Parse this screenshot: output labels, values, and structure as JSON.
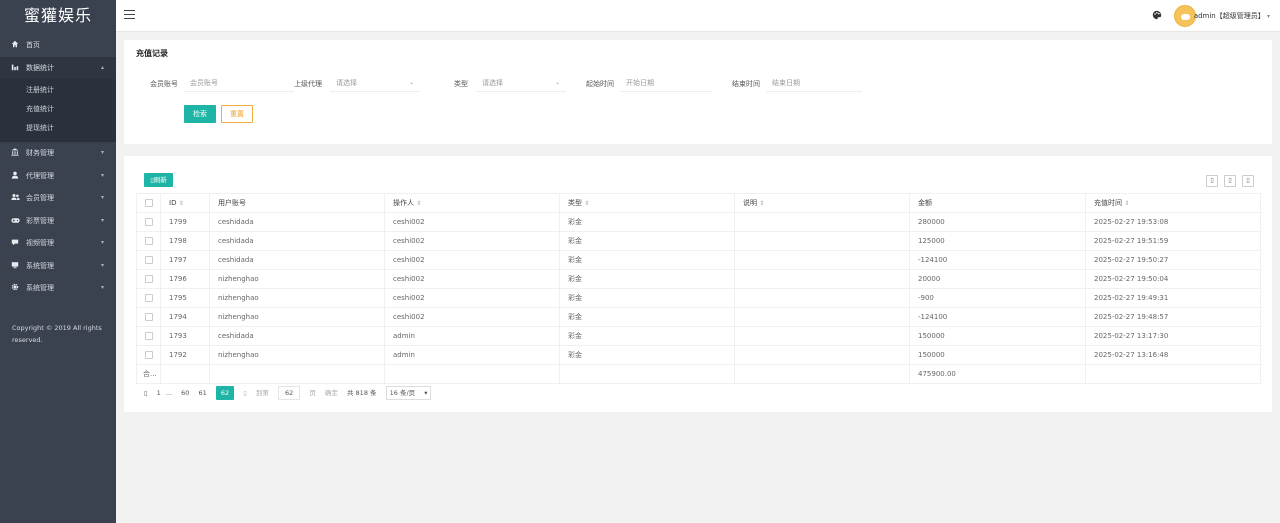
{
  "app": {
    "logo": "蜜獾娱乐"
  },
  "sidebar": {
    "home": {
      "label": "首页",
      "icon": "home-icon"
    },
    "stats": {
      "label": "数据统计",
      "icon": "chart-icon",
      "expanded": true,
      "children": [
        "注册统计",
        "充值统计",
        "提现统计"
      ]
    },
    "items": [
      {
        "label": "财务管理",
        "icon": "bank-icon"
      },
      {
        "label": "代理管理",
        "icon": "user-icon"
      },
      {
        "label": "会员管理",
        "icon": "users-icon"
      },
      {
        "label": "彩票管理",
        "icon": "gamepad-icon"
      },
      {
        "label": "视频管理",
        "icon": "video-icon"
      },
      {
        "label": "系统管理",
        "icon": "monitor-icon"
      },
      {
        "label": "系统管理",
        "icon": "gear-icon"
      }
    ],
    "copyright": "Copyright © 2019 All rights reserved."
  },
  "topbar": {
    "user": "admin【超级管理员】",
    "theme_icon": "palette-icon",
    "dropdown": "▾"
  },
  "filters": {
    "title": "充值记录",
    "member_label": "会员账号",
    "member_placeholder": "会员账号",
    "agent_label": "上级代理",
    "agent_value": "请选择",
    "type_label": "类型",
    "type_value": "请选择",
    "start_label": "起始时间",
    "start_placeholder": "开始日期",
    "end_label": "结束时间",
    "end_placeholder": "结束日期",
    "search_btn": "检索",
    "reset_btn": "重置"
  },
  "table": {
    "refresh_btn": "刷新",
    "columns": [
      "ID",
      "用户账号",
      "操作人",
      "类型",
      "说明",
      "金额",
      "充值时间"
    ],
    "rows": [
      {
        "id": "1799",
        "account": "ceshidada",
        "operator": "ceshi002",
        "type": "彩金",
        "note": "",
        "amount": "280000",
        "time": "2025-02-27 19:53:08"
      },
      {
        "id": "1798",
        "account": "ceshidada",
        "operator": "ceshi002",
        "type": "彩金",
        "note": "",
        "amount": "125000",
        "time": "2025-02-27 19:51:59"
      },
      {
        "id": "1797",
        "account": "ceshidada",
        "operator": "ceshi002",
        "type": "彩金",
        "note": "",
        "amount": "-124100",
        "time": "2025-02-27 19:50:27"
      },
      {
        "id": "1796",
        "account": "nizhenghao",
        "operator": "ceshi002",
        "type": "彩金",
        "note": "",
        "amount": "20000",
        "time": "2025-02-27 19:50:04"
      },
      {
        "id": "1795",
        "account": "nizhenghao",
        "operator": "ceshi002",
        "type": "彩金",
        "note": "",
        "amount": "-900",
        "time": "2025-02-27 19:49:31"
      },
      {
        "id": "1794",
        "account": "nizhenghao",
        "operator": "ceshi002",
        "type": "彩金",
        "note": "",
        "amount": "-124100",
        "time": "2025-02-27 19:48:57"
      },
      {
        "id": "1793",
        "account": "ceshidada",
        "operator": "admin",
        "type": "彩金",
        "note": "",
        "amount": "150000",
        "time": "2025-02-27 13:17:30"
      },
      {
        "id": "1792",
        "account": "nizhenghao",
        "operator": "admin",
        "type": "彩金",
        "note": "",
        "amount": "150000",
        "time": "2025-02-27 13:16:48"
      }
    ],
    "total_label": "合...",
    "total_amount": "475900.00"
  },
  "pager": {
    "pages": [
      "1",
      "...",
      "60",
      "61"
    ],
    "current": "62",
    "goto_label": "到第",
    "goto_value": "62",
    "page_unit": "页",
    "confirm": "确定",
    "total": "共 818 条",
    "per_page": "16 条/页"
  }
}
